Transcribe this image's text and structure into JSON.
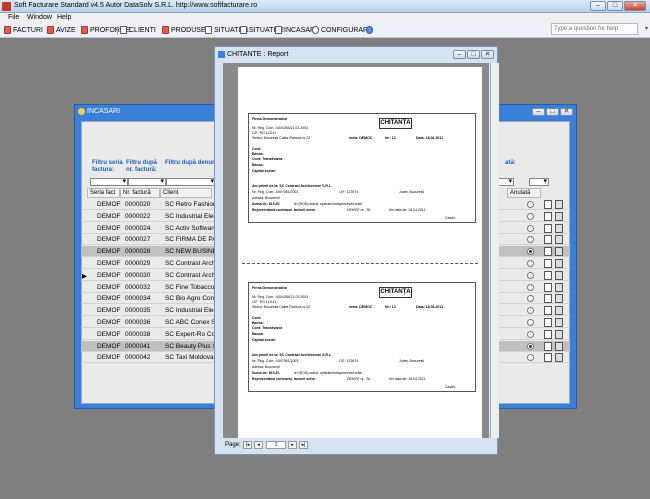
{
  "app": {
    "title": "Soft Facturare Standard v4.5 Autor DataSolv S.R.L. http://www.softfacturare.ro"
  },
  "menu": [
    "File",
    "Window",
    "Help"
  ],
  "help_search": {
    "placeholder": "Type a question for help"
  },
  "toolbar": [
    {
      "label": "FACTURI",
      "icon": "invoice-icon"
    },
    {
      "label": "AVIZE",
      "icon": "notice-icon"
    },
    {
      "label": "PROFORME",
      "icon": "proforma-icon"
    },
    {
      "label": "CLIENTI",
      "icon": "clients-icon"
    },
    {
      "label": "PRODUSE",
      "icon": "products-icon"
    },
    {
      "label": "SITUATIE1",
      "icon": "report-icon"
    },
    {
      "label": "SITUATIE2",
      "icon": "report-icon"
    },
    {
      "label": "INCASARI",
      "icon": "receipts-icon"
    },
    {
      "label": "CONFIGURARE",
      "icon": "settings-icon"
    }
  ],
  "incasari": {
    "title": "INCASARI",
    "filters": [
      "Filtru seria factura:",
      "Filtru după nr. factură:",
      "Filtru după denum",
      "ată:"
    ],
    "columns": [
      "Seria fact",
      "Nr. factură",
      "Client",
      "Anulată"
    ],
    "rows": [
      {
        "seria": "DEMOF",
        "nr": "0000020",
        "client": "SC Retro Fashion",
        "anulata": false,
        "sel": false
      },
      {
        "seria": "DEMOF",
        "nr": "0000022",
        "client": "SC Industrial Elect",
        "anulata": false,
        "sel": false
      },
      {
        "seria": "DEMOF",
        "nr": "0000024",
        "client": "SC Activ Software",
        "anulata": false,
        "sel": false
      },
      {
        "seria": "DEMOF",
        "nr": "0000027",
        "client": "SC FIRMA DE PA3",
        "anulata": false,
        "sel": false
      },
      {
        "seria": "DEMOF",
        "nr": "0000028",
        "client": "SC NEW BUSINES",
        "anulata": true,
        "sel": true
      },
      {
        "seria": "DEMOF",
        "nr": "0000029",
        "client": "SC Contrast Archi",
        "anulata": false,
        "sel": false
      },
      {
        "seria": "DEMOF",
        "nr": "0000030",
        "client": "SC Contrast Archi",
        "anulata": false,
        "sel": false
      },
      {
        "seria": "DEMOF",
        "nr": "0000032",
        "client": "SC Fine Tobacco",
        "anulata": false,
        "sel": false
      },
      {
        "seria": "DEMOF",
        "nr": "0000034",
        "client": "SC Bio Agro Conc",
        "anulata": false,
        "sel": false
      },
      {
        "seria": "DEMOF",
        "nr": "0000035",
        "client": "SC Industrial Elect",
        "anulata": false,
        "sel": false
      },
      {
        "seria": "DEMOF",
        "nr": "0000036",
        "client": "SC ABC Conex S.",
        "anulata": false,
        "sel": false
      },
      {
        "seria": "DEMOF",
        "nr": "0000038",
        "client": "SC Expert-Ro Con",
        "anulata": false,
        "sel": false
      },
      {
        "seria": "DEMOF",
        "nr": "0000041",
        "client": "SC Beauty Plus S.",
        "anulata": true,
        "sel": true
      },
      {
        "seria": "DEMOF",
        "nr": "0000042",
        "client": "SC Taxi Moldova S",
        "anulata": false,
        "sel": false
      }
    ]
  },
  "report": {
    "title": "CHITANTE : Report",
    "page_label": "Page:",
    "page_number": "1",
    "receipt": {
      "company": "Firma Demonstrativa",
      "heading": "CHITANȚA",
      "reg_com": "Nr. Reg. Com: J40/4284/21.03.2003",
      "cif": "CIF:  RO 111111",
      "sediu": "Sediul: Bucuresti Calea Rahova nr.22",
      "serie_label": "seria:  DEMOC",
      "nr_label": "Nr.:     12",
      "data_label": "Data:     18.04.2011",
      "cont1": "Cont:",
      "banca": "Banca:",
      "cont2": "Cont: Transilvania",
      "banca2": "Banca:",
      "capital": "Capital social:",
      "am_primit": "Am primit de la:    SC Contrast Architecture S.R.L.",
      "client_reg": "Nr. Reg. Com:  J40/7081/2003",
      "client_cif": "CIF:  123974",
      "client_judet": "Județ:  Bucuresti",
      "adresa": "Adresa:    Bucuresti",
      "suma": "Suma de:    815,30",
      "suma_lei": "lei (RON) adică:   optsutecincisprezece/ronlei",
      "reprezentand": "Reprezentând contraval. facturii seria:",
      "factura_serie": "DEMOF    nr.: 30",
      "factura_data": "din data de:    18.04.2011",
      "casier": "Casier,"
    }
  }
}
